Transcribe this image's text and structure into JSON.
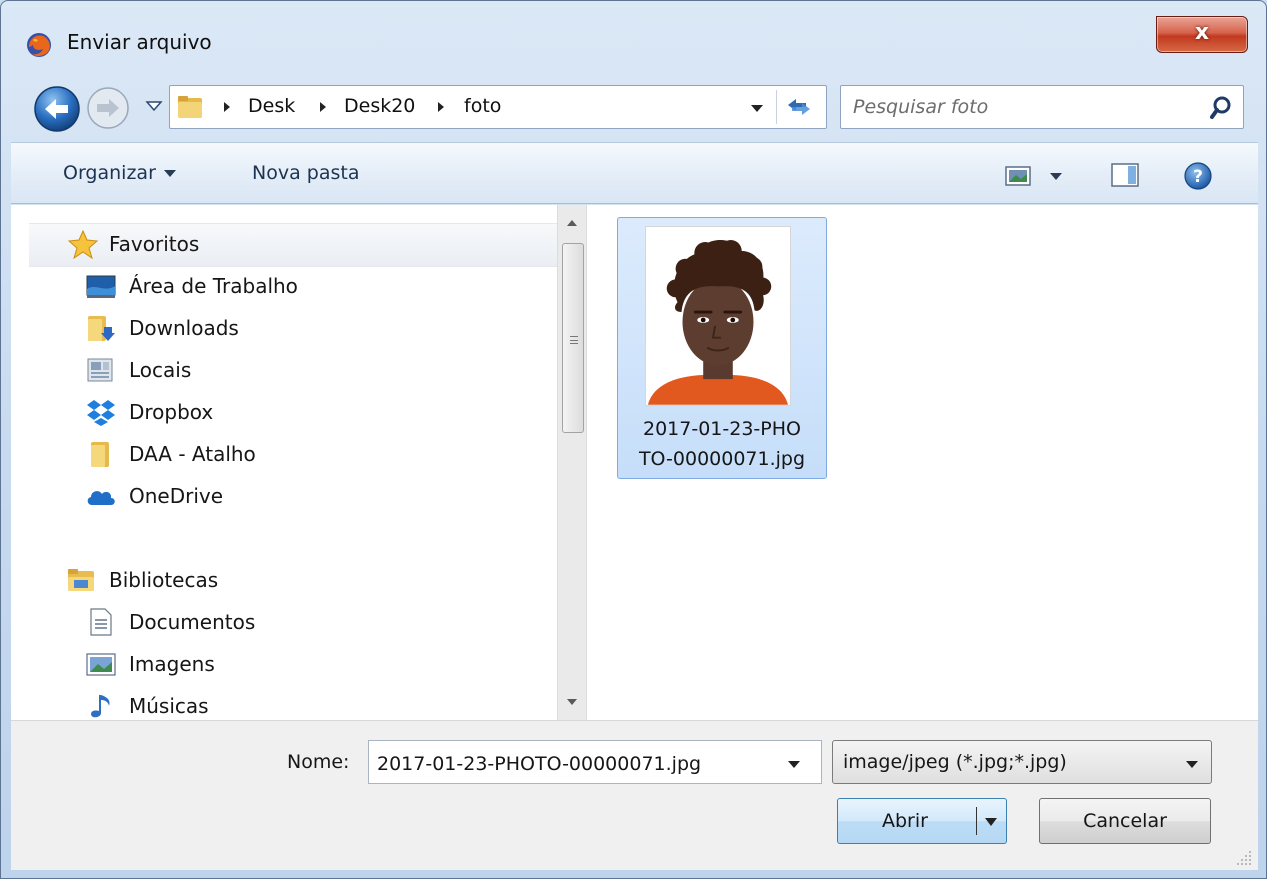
{
  "window": {
    "title": "Enviar arquivo",
    "close_label": "x"
  },
  "address": {
    "crumbs": [
      "Desk",
      "Desk20",
      "foto"
    ]
  },
  "search": {
    "placeholder": "Pesquisar foto"
  },
  "toolbar": {
    "organize_label": "Organizar",
    "new_folder_label": "Nova pasta"
  },
  "nav": {
    "favorites_header": "Favoritos",
    "favorites": [
      {
        "label": "Área de Trabalho",
        "icon": "desktop-icon"
      },
      {
        "label": "Downloads",
        "icon": "downloads-folder-icon"
      },
      {
        "label": "Locais",
        "icon": "recent-places-icon"
      },
      {
        "label": "Dropbox",
        "icon": "dropbox-icon"
      },
      {
        "label": "DAA - Atalho",
        "icon": "folder-icon"
      },
      {
        "label": "OneDrive",
        "icon": "onedrive-icon"
      }
    ],
    "libraries_header": "Bibliotecas",
    "libraries": [
      {
        "label": "Documentos",
        "icon": "documents-icon"
      },
      {
        "label": "Imagens",
        "icon": "pictures-icon"
      },
      {
        "label": "Músicas",
        "icon": "music-icon"
      }
    ]
  },
  "files": [
    {
      "name": "2017-01-23-PHOTO-00000071.jpg",
      "name_line1": "2017-01-23-PHO",
      "name_line2": "TO-00000071.jpg",
      "selected": true
    }
  ],
  "footer": {
    "name_label": "Nome:",
    "name_value": "2017-01-23-PHOTO-00000071.jpg",
    "filetype": "image/jpeg (*.jpg;*.jpg)",
    "open_label": "Abrir",
    "cancel_label": "Cancelar"
  },
  "colors": {
    "accent": "#3c7fb1",
    "selection": "#c6defa",
    "close": "#c2391f"
  }
}
